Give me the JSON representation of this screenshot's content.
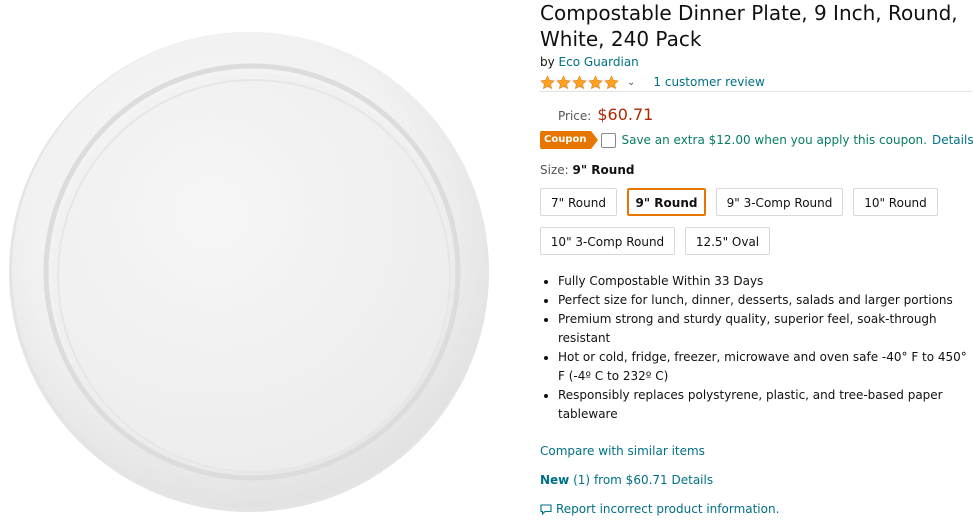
{
  "product": {
    "title": "Compostable Dinner Plate, 9 Inch, Round, White, 240 Pack",
    "by_prefix": "by",
    "brand": "Eco Guardian",
    "rating_stars": 5,
    "review_link": "1 customer review"
  },
  "price": {
    "label": "Price:",
    "value": "$60.71"
  },
  "coupon": {
    "badge": "Coupon",
    "text": "Save an extra $12.00 when you apply this coupon.",
    "details": "Details",
    "checked": false
  },
  "size": {
    "label": "Size:",
    "selected": "9\" Round",
    "options": [
      "7\" Round",
      "9\" Round",
      "9\" 3-Comp Round",
      "10\" Round",
      "10\" 3-Comp Round",
      "12.5\" Oval"
    ]
  },
  "features": [
    "Fully Compostable Within 33 Days",
    "Perfect size for lunch, dinner, desserts, salads and larger portions",
    "Premium strong and sturdy quality, superior feel, soak-through resistant",
    "Hot or cold, fridge, freezer, microwave and oven safe -40° F to 450° F (-4º C to 232º C)",
    "Responsibly replaces polystyrene, plastic, and tree-based paper tableware"
  ],
  "links": {
    "compare": "Compare with similar items",
    "new_label": "New",
    "new_count": "(1)",
    "new_from": "from $60.71",
    "new_details": "Details",
    "report": "Report incorrect product information."
  },
  "colors": {
    "link": "#007185",
    "price": "#B12704",
    "coupon_badge": "#E77600",
    "coupon_text": "#067D62",
    "star": "#FFA41C"
  },
  "icons": {
    "star": "star-icon",
    "chevron": "chevron-down-icon",
    "report": "speech-bubble-icon"
  }
}
